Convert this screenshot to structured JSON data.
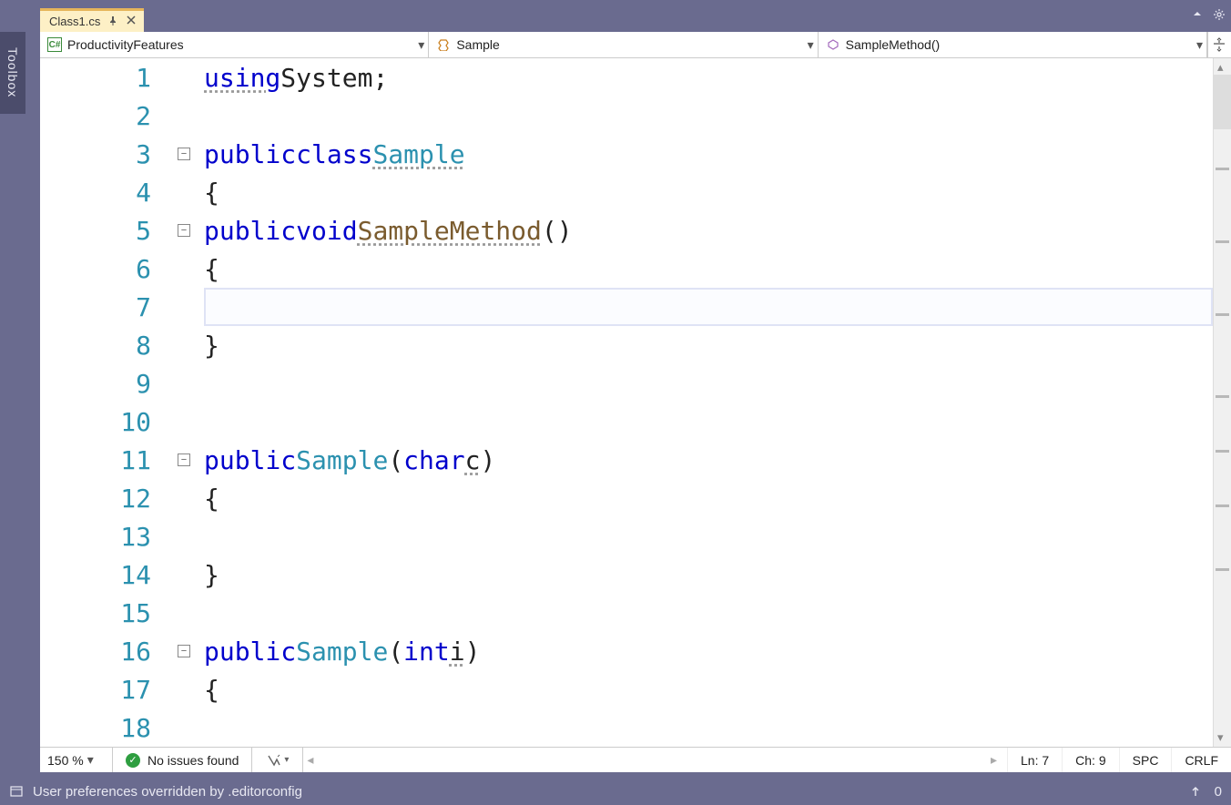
{
  "tab": {
    "filename": "Class1.cs"
  },
  "toolbox": {
    "label": "Toolbox"
  },
  "nav": {
    "project": "ProductivityFeatures",
    "class": "Sample",
    "member": "SampleMethod()"
  },
  "code": {
    "lines": [
      1,
      2,
      3,
      4,
      5,
      6,
      7,
      8,
      9,
      10,
      11,
      12,
      13,
      14,
      15,
      16,
      17,
      18
    ],
    "l1": {
      "kw": "using",
      "ns": "System",
      "semi": ";"
    },
    "l3": {
      "kw1": "public",
      "kw2": "class",
      "name": "Sample"
    },
    "l4": {
      "brace": "{"
    },
    "l5": {
      "kw1": "public",
      "kw2": "void",
      "name": "SampleMethod",
      "paren": "()"
    },
    "l6": {
      "brace": "{"
    },
    "l8": {
      "brace": "}"
    },
    "l11": {
      "kw1": "public",
      "name": "Sample",
      "open": "(",
      "ptype": "char",
      "pname": "c",
      "close": ")"
    },
    "l12": {
      "brace": "{"
    },
    "l14": {
      "brace": "}"
    },
    "l16": {
      "kw1": "public",
      "name": "Sample",
      "open": "(",
      "ptype": "int",
      "pname": "i",
      "close": ")"
    },
    "l17": {
      "brace": "{"
    }
  },
  "bottom": {
    "zoom": "150 %",
    "issues": "No issues found",
    "ln_label": "Ln:",
    "ln": "7",
    "ch_label": "Ch:",
    "ch": "9",
    "indent": "SPC",
    "eol": "CRLF"
  },
  "status": {
    "message": "User preferences overridden by .editorconfig",
    "count": "0"
  }
}
